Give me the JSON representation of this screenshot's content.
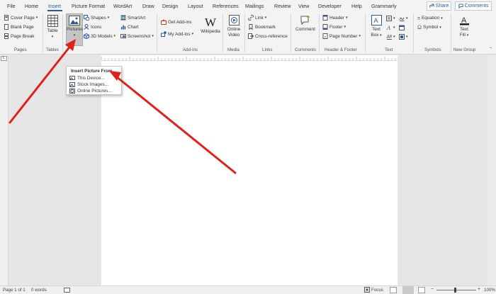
{
  "tabs": [
    "File",
    "Home",
    "Insert",
    "Picture Format",
    "WordArt",
    "Draw",
    "Design",
    "Layout",
    "References",
    "Mailings",
    "Review",
    "View",
    "Developer",
    "Help",
    "Grammarly"
  ],
  "top_buttons": {
    "share": "Share",
    "comments": "Comments"
  },
  "ribbon": {
    "pages": {
      "items": [
        "Cover Page",
        "Blank Page",
        "Page Break"
      ],
      "label": "Pages"
    },
    "tables": {
      "table": "Table",
      "label": "Tables"
    },
    "illustrations": {
      "pictures": "Pictures",
      "shapes": "Shapes",
      "icons": "Icons",
      "models": "3D Models",
      "smartart": "SmartArt",
      "chart": "Chart",
      "screenshot": "Screenshot"
    },
    "addins": {
      "get": "Get Add-ins",
      "my": "My Add-ins",
      "wikipedia": "Wikipedia",
      "label": "Add-ins"
    },
    "media": {
      "online_video_1": "Online",
      "online_video_2": "Video",
      "label": "Media"
    },
    "links": {
      "items": [
        "Link",
        "Bookmark",
        "Cross-reference"
      ],
      "label": "Links"
    },
    "comments": {
      "comment": "Comment",
      "label": "Comments"
    },
    "header_footer": {
      "items": [
        "Header",
        "Footer",
        "Page Number"
      ],
      "label": "Header & Footer"
    },
    "text": {
      "textbox_1": "Text",
      "textbox_2": "Box",
      "label": "Text"
    },
    "symbols": {
      "equation": "Equation",
      "symbol": "Symbol",
      "label": "Symbols"
    },
    "newgroup": {
      "textfill_1": "Text",
      "textfill_2": "Fill",
      "label": "New Group"
    }
  },
  "dropdown": {
    "title": "Insert Picture From",
    "items": [
      "This Device...",
      "Stock Images...",
      "Online Pictures..."
    ]
  },
  "status": {
    "page": "Page 1 of 1",
    "words": "0 words",
    "focus": "Focus",
    "zoom": "100%"
  },
  "colors": {
    "accent": "#2b579a",
    "arrow": "#e0201b"
  }
}
